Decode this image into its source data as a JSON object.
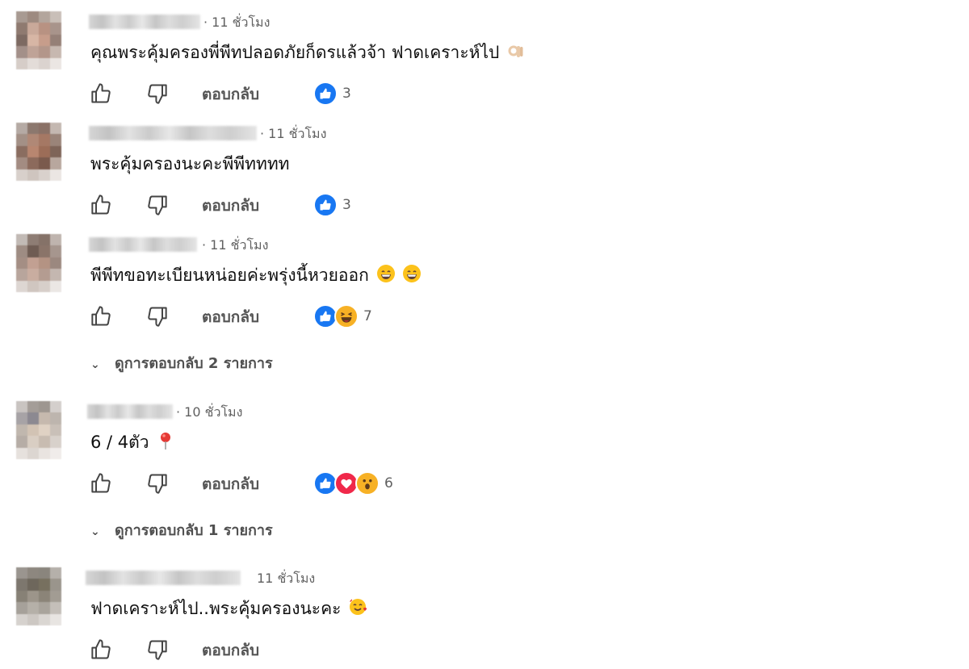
{
  "colors": {
    "like_blue": "#1877f2",
    "heart_red": "#f0284a",
    "haha_yellow": "#f7b125",
    "meta_gray": "#606060"
  },
  "comments": [
    {
      "time": "· 11 ชั่วโมง",
      "text": "คุณพระคุ้มครองพี่พีทปลอดภัยก็ดรแล้วจ้า ฟาดเคราะห์ไป",
      "emoji": "ok-hand-icon",
      "reply_label": "ตอบกลับ",
      "reactions": [
        "like"
      ],
      "reaction_count": "3"
    },
    {
      "time": "· 11 ชั่วโมง",
      "text": "พระคุ้มครองนะคะพีพีทททท",
      "emoji": "",
      "reply_label": "ตอบกลับ",
      "reactions": [
        "like"
      ],
      "reaction_count": "3"
    },
    {
      "time": "· 11 ชั่วโมง",
      "text": "พีพีทขอทะเบียนหน่อยค่ะพรุ่งนี้หวยออก",
      "emoji": "grinning-face-icon x2",
      "reply_label": "ตอบกลับ",
      "reactions": [
        "like",
        "haha"
      ],
      "reaction_count": "7",
      "view_replies": "ดูการตอบกลับ 2 รายการ"
    },
    {
      "time": "· 10 ชั่วโมง",
      "text": "6 / 4ตัว",
      "emoji": "pushpin-icon",
      "reply_label": "ตอบกลับ",
      "reactions": [
        "like",
        "love",
        "wow"
      ],
      "reaction_count": "6",
      "view_replies": "ดูการตอบกลับ 1 รายการ"
    },
    {
      "time": "11 ชั่วโมง",
      "text": "ฟาดเคราะห์ไป..พระคุ้มครองนะคะ",
      "emoji": "smiling-face-with-hearts-icon",
      "reply_label": "ตอบกลับ",
      "reactions": [],
      "reaction_count": ""
    }
  ]
}
